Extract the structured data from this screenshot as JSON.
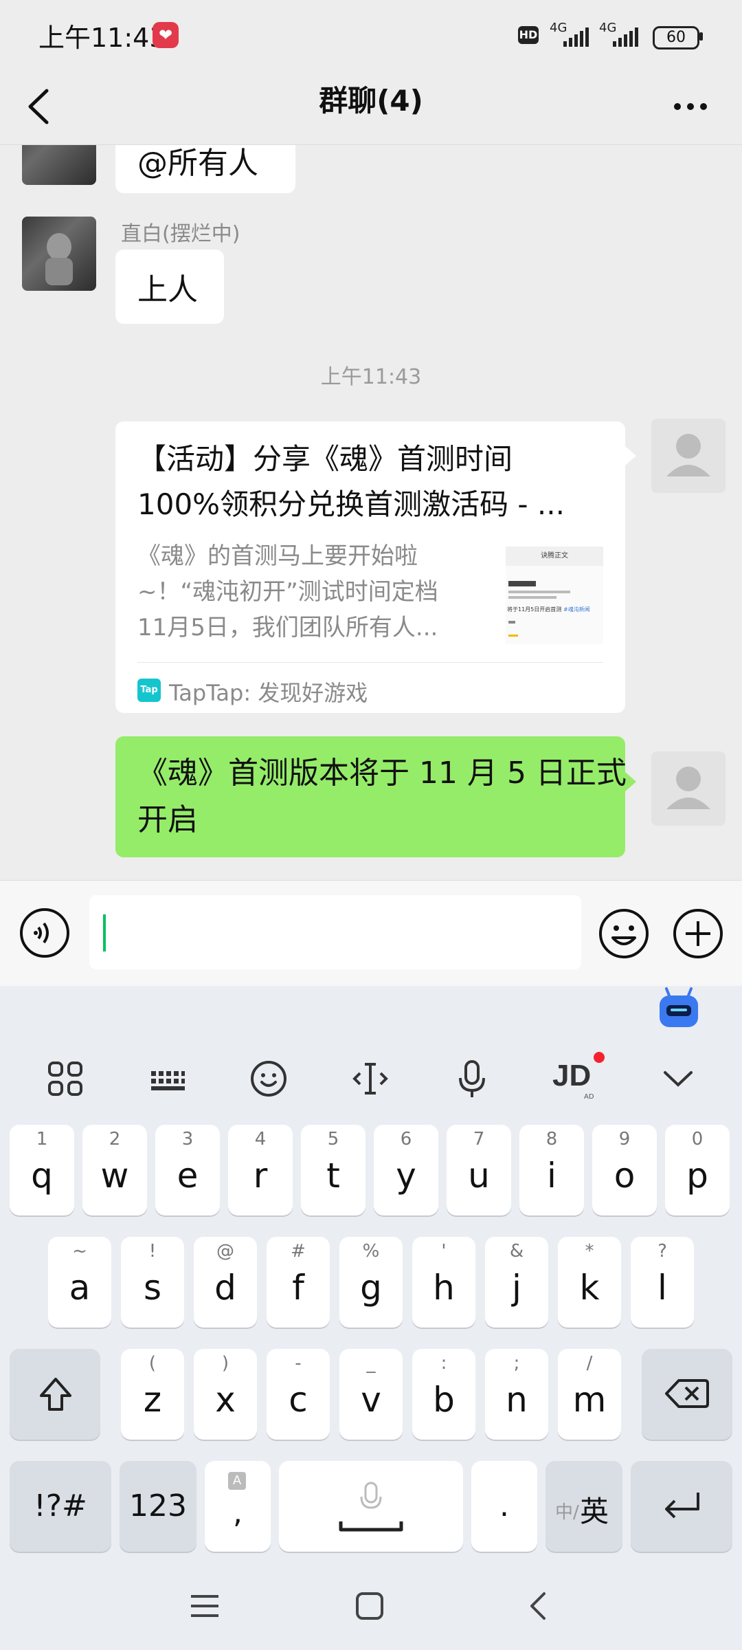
{
  "status_bar": {
    "time": "上午11:43",
    "hd": "HD",
    "net1": "4G",
    "net2": "4G",
    "battery": "60"
  },
  "header": {
    "title": "群聊(4)"
  },
  "messages": [
    {
      "type": "text",
      "side": "left",
      "text": "@所有人"
    },
    {
      "type": "text",
      "side": "left",
      "sender": "直白(摆烂中)",
      "text": "上人"
    },
    {
      "type": "time",
      "text": "上午11:43"
    },
    {
      "type": "link",
      "side": "right",
      "title_line1": "【活动】分享《魂》首测时间",
      "title_line2": "100%领积分兑换首测激活码 - ...",
      "desc_line1": "《魂》的首测马上要开始啦",
      "desc_line2": "~！“魂沌初开”测试时间定档",
      "desc_line3": "11月5日，我们团队所有人...",
      "source_icon": "Tap",
      "source": "TapTap: 发现好游戏",
      "thumb_heading": "诀腾正文",
      "thumb_text": "将于11月5日开启首测",
      "thumb_link": "#魂沌新闻"
    },
    {
      "type": "text",
      "side": "right",
      "line1": "《魂》首测版本将于 11 月 5 日正式",
      "line2": "开启"
    }
  ],
  "keyboard": {
    "tool_icons": [
      "apps-grid-icon",
      "keyboard-icon",
      "emoji-icon",
      "text-cursor-icon",
      "microphone-icon",
      "jd-icon",
      "collapse-icon"
    ],
    "jd_label": "JD",
    "jd_sub": "AD",
    "row1": [
      [
        "1",
        "q"
      ],
      [
        "2",
        "w"
      ],
      [
        "3",
        "e"
      ],
      [
        "4",
        "r"
      ],
      [
        "5",
        "t"
      ],
      [
        "6",
        "y"
      ],
      [
        "7",
        "u"
      ],
      [
        "8",
        "i"
      ],
      [
        "9",
        "o"
      ],
      [
        "0",
        "p"
      ]
    ],
    "row2": [
      [
        "~",
        "a"
      ],
      [
        "!",
        "s"
      ],
      [
        "@",
        "d"
      ],
      [
        "#",
        "f"
      ],
      [
        "%",
        "g"
      ],
      [
        "'",
        "h"
      ],
      [
        "&",
        "j"
      ],
      [
        "*",
        "k"
      ],
      [
        "?",
        "l"
      ]
    ],
    "row3": [
      [
        "(",
        "z"
      ],
      [
        ")",
        "x"
      ],
      [
        "-",
        "c"
      ],
      [
        "_",
        "v"
      ],
      [
        ":",
        "b"
      ],
      [
        ";",
        "n"
      ],
      [
        "/",
        "m"
      ]
    ],
    "symbols_key": "!?#",
    "num_key": "123",
    "comma_hint": "A",
    "comma_key": ",",
    "period_key": ".",
    "lang_small": "中/",
    "lang_big": "英"
  },
  "colors": {
    "accent_green": "#95ec69",
    "caret": "#07c160",
    "badge_red": "#f5222d"
  }
}
